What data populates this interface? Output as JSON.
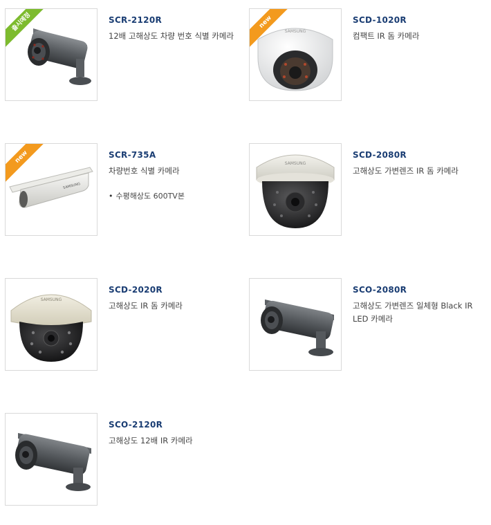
{
  "products": [
    {
      "model": "SCR-2120R",
      "description": "12배 고해상도 차량 번호 식별 카메라",
      "badge": "출시예정",
      "badge_color": "#7dbb2e",
      "camera_type": "bullet",
      "icon": "bullet-camera-icon"
    },
    {
      "model": "SCD-1020R",
      "description": "컴팩트 IR 돔 카메라",
      "badge": "new",
      "badge_color": "#f39a1e",
      "camera_type": "dome-white",
      "icon": "dome-camera-icon"
    },
    {
      "model": "SCR-735A",
      "description": "차량번호 식별 카메라",
      "badge": "new",
      "badge_color": "#f39a1e",
      "camera_type": "housing",
      "icon": "housing-camera-icon",
      "specs": [
        "수평해상도 600TV본"
      ]
    },
    {
      "model": "SCD-2080R",
      "description": "고해상도 가변렌즈 IR 돔 카메라",
      "camera_type": "dome",
      "icon": "dome-camera-icon"
    },
    {
      "model": "SCD-2020R",
      "description": "고해상도 IR 돔 카메라",
      "camera_type": "dome-beige",
      "icon": "dome-camera-icon"
    },
    {
      "model": "SCO-2080R",
      "description": "고해상도 가변렌즈 일체형 Black IR LED 카메라",
      "camera_type": "bullet",
      "icon": "bullet-camera-icon"
    },
    {
      "model": "SCO-2120R",
      "description": "고해상도 12배 IR 카메라",
      "camera_type": "bullet",
      "icon": "bullet-camera-icon"
    }
  ],
  "logo_text": "SAMSUNG"
}
